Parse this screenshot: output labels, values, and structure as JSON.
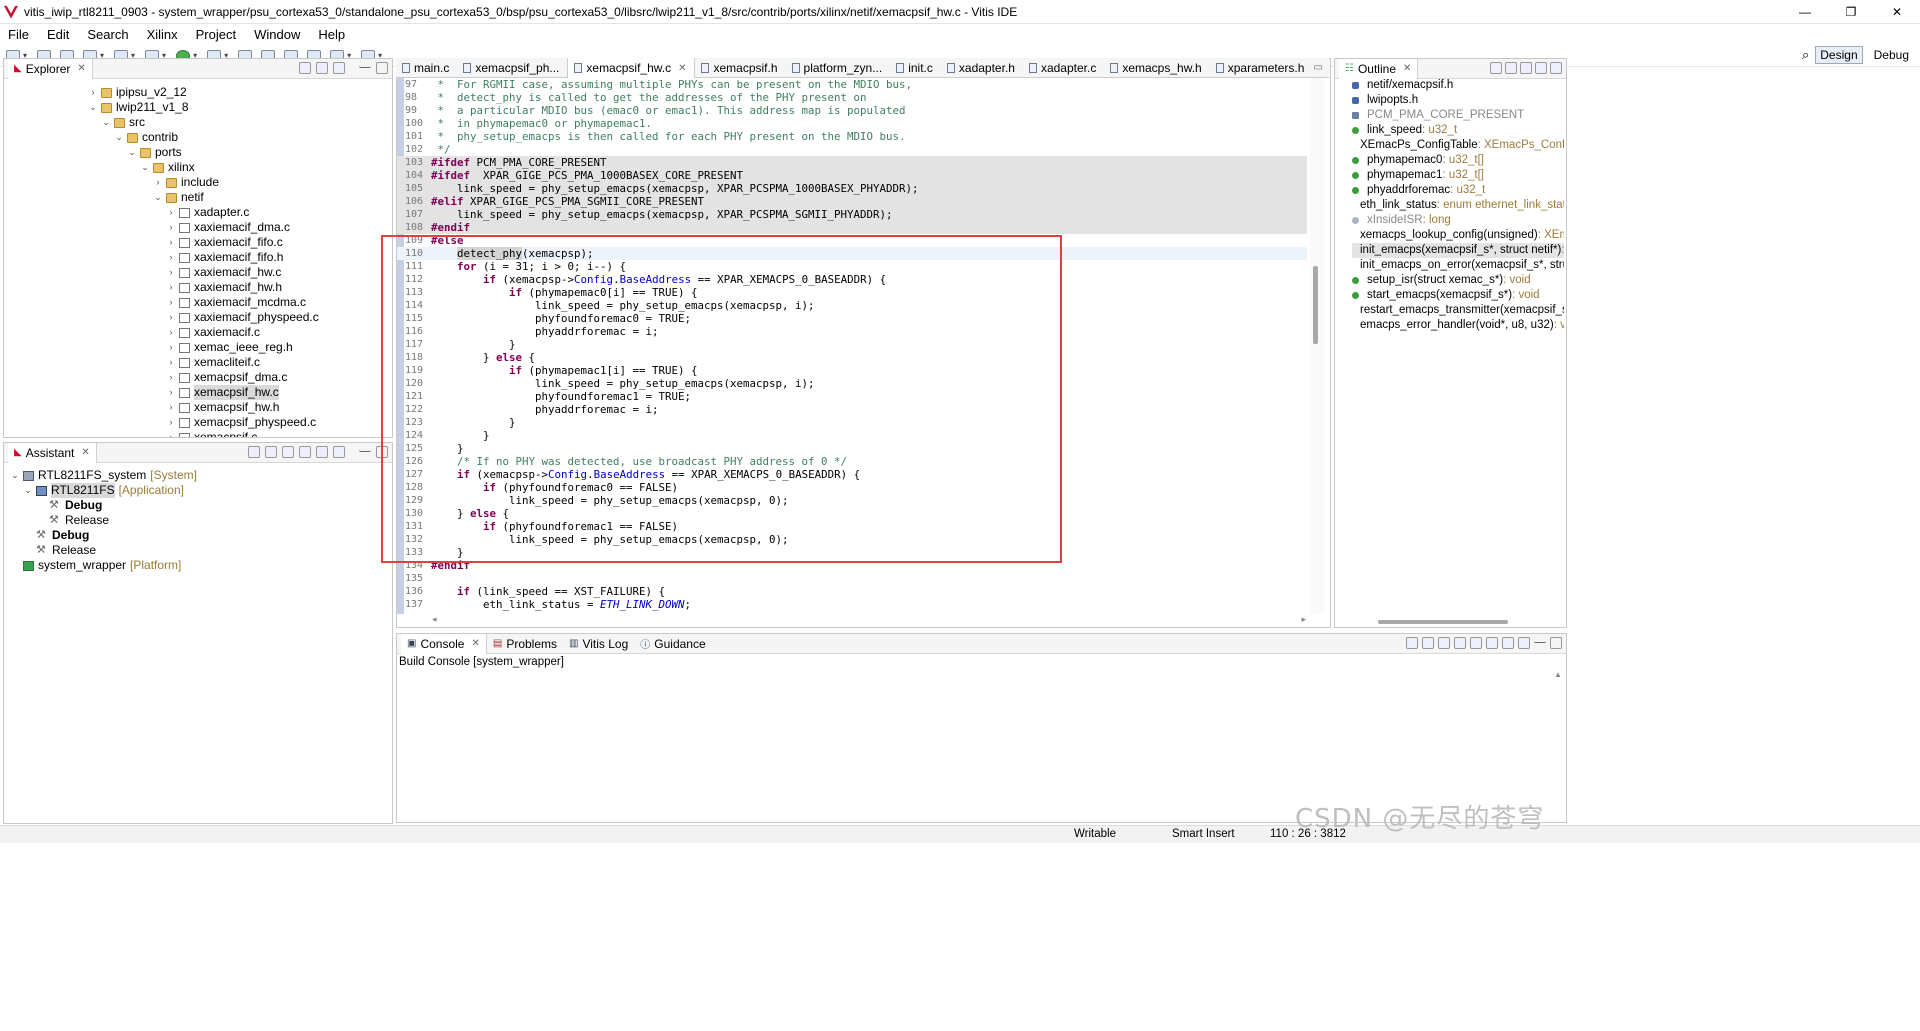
{
  "window": {
    "title": "vitis_iwip_rtl8211_0903 - system_wrapper/psu_cortexa53_0/standalone_psu_cortexa53_0/bsp/psu_cortexa53_0/libsrc/lwip211_v1_8/src/contrib/ports/xilinx/netif/xemacpsif_hw.c - Vitis IDE",
    "controls": [
      "—",
      "❐",
      "✕"
    ]
  },
  "menu": [
    "File",
    "Edit",
    "Search",
    "Xilinx",
    "Project",
    "Window",
    "Help"
  ],
  "perspectives": {
    "design": "Design",
    "debug": "Debug"
  },
  "explorer": {
    "title": "Explorer",
    "items": [
      {
        "label": "ipipsu_v2_12",
        "type": "folder",
        "depth": 0,
        "twisty": "›"
      },
      {
        "label": "lwip211_v1_8",
        "type": "folder",
        "depth": 0,
        "twisty": "⌄"
      },
      {
        "label": "src",
        "type": "folder",
        "depth": 1,
        "twisty": "⌄"
      },
      {
        "label": "contrib",
        "type": "folder",
        "depth": 2,
        "twisty": "⌄"
      },
      {
        "label": "ports",
        "type": "folder",
        "depth": 3,
        "twisty": "⌄"
      },
      {
        "label": "xilinx",
        "type": "folder",
        "depth": 4,
        "twisty": "⌄"
      },
      {
        "label": "include",
        "type": "folder",
        "depth": 5,
        "twisty": "›"
      },
      {
        "label": "netif",
        "type": "folder",
        "depth": 5,
        "twisty": "⌄"
      },
      {
        "label": "xadapter.c",
        "type": "file",
        "depth": 6,
        "twisty": "›"
      },
      {
        "label": "xaxiemacif_dma.c",
        "type": "file",
        "depth": 6,
        "twisty": "›"
      },
      {
        "label": "xaxiemacif_fifo.c",
        "type": "file",
        "depth": 6,
        "twisty": "›"
      },
      {
        "label": "xaxiemacif_fifo.h",
        "type": "file",
        "depth": 6,
        "twisty": "›"
      },
      {
        "label": "xaxiemacif_hw.c",
        "type": "file",
        "depth": 6,
        "twisty": "›"
      },
      {
        "label": "xaxiemacif_hw.h",
        "type": "file",
        "depth": 6,
        "twisty": "›"
      },
      {
        "label": "xaxiemacif_mcdma.c",
        "type": "file",
        "depth": 6,
        "twisty": "›"
      },
      {
        "label": "xaxiemacif_physpeed.c",
        "type": "file",
        "depth": 6,
        "twisty": "›"
      },
      {
        "label": "xaxiemacif.c",
        "type": "file",
        "depth": 6,
        "twisty": "›"
      },
      {
        "label": "xemac_ieee_reg.h",
        "type": "file",
        "depth": 6,
        "twisty": "›"
      },
      {
        "label": "xemacliteif.c",
        "type": "file",
        "depth": 6,
        "twisty": "›"
      },
      {
        "label": "xemacpsif_dma.c",
        "type": "file",
        "depth": 6,
        "twisty": "›"
      },
      {
        "label": "xemacpsif_hw.c",
        "type": "file",
        "depth": 6,
        "twisty": "›",
        "selected": true
      },
      {
        "label": "xemacpsif_hw.h",
        "type": "file",
        "depth": 6,
        "twisty": "›"
      },
      {
        "label": "xemacpsif_physpeed.c",
        "type": "file",
        "depth": 6,
        "twisty": "›"
      },
      {
        "label": "xemacpsif.c",
        "type": "file",
        "depth": 6,
        "twisty": "›"
      }
    ]
  },
  "assistant": {
    "title": "Assistant",
    "items": [
      {
        "label": "RTL8211FS_system",
        "tag": "[System]",
        "icon": "sys",
        "depth": 0,
        "twisty": "⌄"
      },
      {
        "label": "RTL8211FS",
        "tag": "[Application]",
        "icon": "app",
        "depth": 1,
        "twisty": "⌄",
        "selected": true
      },
      {
        "label": "Debug",
        "tag": "",
        "icon": "hammer",
        "depth": 2,
        "bold": true
      },
      {
        "label": "Release",
        "tag": "",
        "icon": "hammer",
        "depth": 2
      },
      {
        "label": "Debug",
        "tag": "",
        "icon": "hammer",
        "depth": 1,
        "bold": true
      },
      {
        "label": "Release",
        "tag": "",
        "icon": "hammer",
        "depth": 1
      },
      {
        "label": "system_wrapper",
        "tag": "[Platform]",
        "icon": "plat",
        "depth": 0
      }
    ]
  },
  "editor": {
    "tabs": [
      {
        "label": "main.c"
      },
      {
        "label": "xemacpsif_ph..."
      },
      {
        "label": "xemacpsif_hw.c",
        "active": true
      },
      {
        "label": "xemacpsif.h"
      },
      {
        "label": "platform_zyn..."
      },
      {
        "label": "init.c"
      },
      {
        "label": "xadapter.h"
      },
      {
        "label": "xadapter.c"
      },
      {
        "label": "xemacps_hw.h"
      },
      {
        "label": "xparameters.h"
      }
    ],
    "lines": [
      {
        "n": "97",
        "html": "<span class='cm'> *  For RGMII case, assuming multiple PHYs can be present on the MDIO bus,</span>"
      },
      {
        "n": "98",
        "html": "<span class='cm'> *  detect_phy is called to get the addresses of the PHY present on</span>"
      },
      {
        "n": "99",
        "html": "<span class='cm'> *  a particular MDIO bus (emac0 or emac1). This address map is populated</span>"
      },
      {
        "n": "100",
        "html": "<span class='cm'> *  in phymapemac0 or phymapemac1.</span>"
      },
      {
        "n": "101",
        "html": "<span class='cm'> *  phy_setup_emacps is then called for each PHY present on the MDIO bus.</span>"
      },
      {
        "n": "102",
        "html": "<span class='cm'> */</span>"
      },
      {
        "n": "103",
        "inactive": true,
        "html": "<span class='pp'>#ifdef</span> PCM_PMA_CORE_PRESENT"
      },
      {
        "n": "104",
        "inactive": true,
        "html": "<span class='pp'>#ifdef</span>  XPAR_GIGE_PCS_PMA_1000BASEX_CORE_PRESENT"
      },
      {
        "n": "105",
        "inactive": true,
        "html": "    link_speed = phy_setup_emacps(xemacpsp, XPAR_PCSPMA_1000BASEX_PHYADDR);"
      },
      {
        "n": "106",
        "inactive": true,
        "html": "<span class='pp'>#elif</span> XPAR_GIGE_PCS_PMA_SGMII_CORE_PRESENT"
      },
      {
        "n": "107",
        "inactive": true,
        "html": "    link_speed = phy_setup_emacps(xemacpsp, XPAR_PCSPMA_SGMII_PHYADDR);"
      },
      {
        "n": "108",
        "inactive": true,
        "html": "<span class='pp'>#endif</span>"
      },
      {
        "n": "109",
        "html": "<span class='pp'>#else</span>"
      },
      {
        "n": "110",
        "cur": true,
        "html": "    <span class='hl'>detect_phy</span>(xemacpsp);"
      },
      {
        "n": "111",
        "html": "    <span class='kw'>for</span> (i = 31; i &gt; 0; i--) {"
      },
      {
        "n": "112",
        "html": "        <span class='kw'>if</span> (xemacpsp-&gt;<span class='fld'>Config</span>.<span class='fld'>BaseAddress</span> == XPAR_XEMACPS_0_BASEADDR) {"
      },
      {
        "n": "113",
        "html": "            <span class='kw'>if</span> (phymapemac0[i] == TRUE) {"
      },
      {
        "n": "114",
        "html": "                link_speed = phy_setup_emacps(xemacpsp, i);"
      },
      {
        "n": "115",
        "html": "                phyfoundforemac0 = TRUE;"
      },
      {
        "n": "116",
        "html": "                phyaddrforemac = i;"
      },
      {
        "n": "117",
        "html": "            }"
      },
      {
        "n": "118",
        "html": "        } <span class='kw'>else</span> {"
      },
      {
        "n": "119",
        "html": "            <span class='kw'>if</span> (phymapemac1[i] == TRUE) {"
      },
      {
        "n": "120",
        "html": "                link_speed = phy_setup_emacps(xemacpsp, i);"
      },
      {
        "n": "121",
        "html": "                phyfoundforemac1 = TRUE;"
      },
      {
        "n": "122",
        "html": "                phyaddrforemac = i;"
      },
      {
        "n": "123",
        "html": "            }"
      },
      {
        "n": "124",
        "html": "        }"
      },
      {
        "n": "125",
        "html": "    }"
      },
      {
        "n": "126",
        "html": "    <span class='cm'>/* If no PHY was detected, use broadcast PHY address of 0 */</span>"
      },
      {
        "n": "127",
        "html": "    <span class='kw'>if</span> (xemacpsp-&gt;<span class='fld'>Config</span>.<span class='fld'>BaseAddress</span> == XPAR_XEMACPS_0_BASEADDR) {"
      },
      {
        "n": "128",
        "html": "        <span class='kw'>if</span> (phyfoundforemac0 == FALSE)"
      },
      {
        "n": "129",
        "html": "            link_speed = phy_setup_emacps(xemacpsp, 0);"
      },
      {
        "n": "130",
        "html": "    } <span class='kw'>else</span> {"
      },
      {
        "n": "131",
        "html": "        <span class='kw'>if</span> (phyfoundforemac1 == FALSE)"
      },
      {
        "n": "132",
        "html": "            link_speed = phy_setup_emacps(xemacpsp, 0);"
      },
      {
        "n": "133",
        "html": "    }"
      },
      {
        "n": "134",
        "html": "<span class='pp'>#endif</span>"
      },
      {
        "n": "135",
        "html": ""
      },
      {
        "n": "136",
        "html": "    <span class='kw'>if</span> (link_speed == XST_FAILURE) {"
      },
      {
        "n": "137",
        "html": "        eth_link_status = <span class='enm'>ETH_LINK_DOWN</span>;"
      }
    ]
  },
  "outline": {
    "title": "Outline",
    "items": [
      {
        "name": "netif/xemacpsif.h",
        "type": "",
        "icon": "blue"
      },
      {
        "name": "lwipopts.h",
        "type": "",
        "icon": "blue"
      },
      {
        "name": "PCM_PMA_CORE_PRESENT",
        "type": "",
        "icon": "hash",
        "gray": true
      },
      {
        "name": "link_speed",
        "type": " : u32_t",
        "icon": "dot"
      },
      {
        "name": "XEmacPs_ConfigTable",
        "type": " : XEmacPs_Config[]",
        "icon": "dot"
      },
      {
        "name": "phymapemac0",
        "type": " : u32_t[]",
        "icon": "dot"
      },
      {
        "name": "phymapemac1",
        "type": " : u32_t[]",
        "icon": "dot"
      },
      {
        "name": "phyaddrforemac",
        "type": " : u32_t",
        "icon": "dot"
      },
      {
        "name": "eth_link_status",
        "type": " : enum ethernet_link_status",
        "icon": "dot"
      },
      {
        "name": "xInsideISR",
        "type": " : long",
        "icon": "light",
        "gray": true
      },
      {
        "name": "xemacps_lookup_config(unsigned)",
        "type": " : XEmacPs_Config*",
        "icon": "dot"
      },
      {
        "name": "init_emacps(xemacpsif_s*, struct netif*)",
        "type": " : void",
        "icon": "dot",
        "selected": true
      },
      {
        "name": "init_emacps_on_error(xemacpsif_s*, struct netif*)",
        "type": "",
        "icon": "dot"
      },
      {
        "name": "setup_isr(struct xemac_s*)",
        "type": " : void",
        "icon": "dot"
      },
      {
        "name": "start_emacps(xemacpsif_s*)",
        "type": " : void",
        "icon": "dot"
      },
      {
        "name": "restart_emacps_transmitter(xemacpsif_s*)",
        "type": "",
        "icon": "dot"
      },
      {
        "name": "emacps_error_handler(void*, u8, u32)",
        "type": " : void",
        "icon": "dot"
      }
    ]
  },
  "console": {
    "tabs": [
      "Console",
      "Problems",
      "Vitis Log",
      "Guidance"
    ],
    "heading": "Build Console [system_wrapper]"
  },
  "status": {
    "writable": "Writable",
    "insert": "Smart Insert",
    "position": "110 : 26 : 3812"
  },
  "watermark": "CSDN @无尽的苍穹"
}
